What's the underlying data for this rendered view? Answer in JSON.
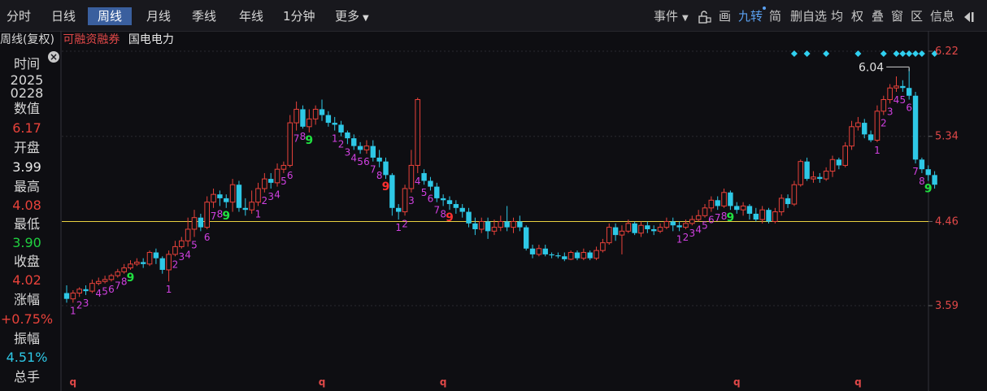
{
  "tabs": [
    {
      "label": "分时",
      "active": false
    },
    {
      "label": "日线",
      "active": false
    },
    {
      "label": "周线",
      "active": true
    },
    {
      "label": "月线",
      "active": false
    },
    {
      "label": "季线",
      "active": false
    },
    {
      "label": "年线",
      "active": false
    },
    {
      "label": "1分钟",
      "active": false
    },
    {
      "label": "更多",
      "active": false
    }
  ],
  "tools": [
    "事件",
    "画",
    "九转",
    "简",
    "删自选",
    "均",
    "权",
    "叠",
    "窗",
    "区",
    "信息"
  ],
  "subtitle": {
    "period": "周线(复权)",
    "tag": "可融资融券",
    "name": "国电电力"
  },
  "sidebar": [
    {
      "label": "时间",
      "value": "2025"
    },
    {
      "label": "",
      "value": "0228"
    },
    {
      "label": "数值",
      "value": "6.17"
    },
    {
      "label": "开盘",
      "value": "3.99"
    },
    {
      "label": "最高",
      "value": "4.08"
    },
    {
      "label": "最低",
      "value": "3.90"
    },
    {
      "label": "收盘",
      "value": "4.02"
    },
    {
      "label": "涨幅",
      "value": "+0.75%"
    },
    {
      "label": "振幅",
      "value": "4.51%"
    },
    {
      "label": "总手",
      "value": ""
    }
  ],
  "colors": {
    "up": "#e8423a",
    "down": "#2ec8e6",
    "label_red": "#e04848",
    "count_magenta": "#d040e0",
    "nine_green": "#20e040",
    "nine_red": "#ff3030",
    "crosshair": "#e8d040",
    "active_tab": "#3a5f9e"
  },
  "chart_data": {
    "type": "candlestick",
    "y_ticks": [
      6.22,
      5.34,
      4.46,
      3.59
    ],
    "ylim": [
      3.3,
      6.5
    ],
    "crosshair_value": 4.46,
    "high_label": "6.04",
    "candles": [
      [
        3.72,
        3.66,
        3.8,
        3.62
      ],
      [
        3.66,
        3.72,
        3.75,
        3.62
      ],
      [
        3.72,
        3.76,
        3.78,
        3.68
      ],
      [
        3.76,
        3.74,
        3.8,
        3.7
      ],
      [
        3.74,
        3.82,
        3.86,
        3.72
      ],
      [
        3.82,
        3.84,
        3.88,
        3.8
      ],
      [
        3.84,
        3.86,
        3.9,
        3.82
      ],
      [
        3.86,
        3.9,
        3.92,
        3.84
      ],
      [
        3.9,
        3.94,
        3.97,
        3.88
      ],
      [
        3.94,
        3.98,
        4.02,
        3.92
      ],
      [
        3.98,
        4.02,
        4.06,
        3.96
      ],
      [
        4.02,
        4.04,
        4.08,
        4.0
      ],
      [
        4.04,
        4.02,
        4.08,
        3.98
      ],
      [
        4.02,
        4.14,
        4.16,
        4.0
      ],
      [
        4.14,
        4.08,
        4.18,
        4.02
      ],
      [
        4.08,
        3.96,
        4.1,
        3.92
      ],
      [
        3.96,
        4.12,
        4.16,
        3.84
      ],
      [
        4.12,
        4.2,
        4.26,
        4.1
      ],
      [
        4.2,
        4.26,
        4.3,
        4.18
      ],
      [
        4.26,
        4.38,
        4.5,
        4.2
      ],
      [
        4.38,
        4.5,
        4.58,
        4.3
      ],
      [
        4.5,
        4.4,
        4.54,
        4.36
      ],
      [
        4.4,
        4.66,
        4.72,
        4.38
      ],
      [
        4.66,
        4.74,
        4.8,
        4.6
      ],
      [
        4.74,
        4.7,
        4.78,
        4.62
      ],
      [
        4.7,
        4.66,
        4.74,
        4.6
      ],
      [
        4.66,
        4.84,
        4.9,
        4.56
      ],
      [
        4.84,
        4.6,
        4.88,
        4.56
      ],
      [
        4.6,
        4.58,
        4.7,
        4.52
      ],
      [
        4.58,
        4.66,
        4.78,
        4.54
      ],
      [
        4.66,
        4.8,
        4.86,
        4.62
      ],
      [
        4.8,
        4.9,
        4.96,
        4.76
      ],
      [
        4.9,
        4.86,
        4.96,
        4.8
      ],
      [
        4.86,
        5.0,
        5.06,
        4.82
      ],
      [
        5.0,
        5.04,
        5.08,
        4.96
      ],
      [
        5.04,
        5.48,
        5.56,
        5.02
      ],
      [
        5.48,
        5.62,
        5.7,
        5.4
      ],
      [
        5.62,
        5.44,
        5.66,
        5.42
      ],
      [
        5.44,
        5.52,
        5.62,
        5.38
      ],
      [
        5.52,
        5.62,
        5.66,
        5.46
      ],
      [
        5.62,
        5.56,
        5.72,
        5.5
      ],
      [
        5.56,
        5.48,
        5.6,
        5.44
      ],
      [
        5.48,
        5.46,
        5.54,
        5.4
      ],
      [
        5.46,
        5.38,
        5.5,
        5.34
      ],
      [
        5.38,
        5.32,
        5.4,
        5.26
      ],
      [
        5.32,
        5.24,
        5.36,
        5.2
      ],
      [
        5.24,
        5.2,
        5.28,
        5.16
      ],
      [
        5.2,
        5.24,
        5.3,
        5.16
      ],
      [
        5.24,
        5.12,
        5.3,
        5.08
      ],
      [
        5.12,
        5.08,
        5.2,
        5.02
      ],
      [
        5.08,
        4.94,
        5.12,
        4.9
      ],
      [
        4.94,
        4.6,
        4.96,
        4.52
      ],
      [
        4.6,
        4.56,
        4.64,
        4.48
      ],
      [
        4.56,
        4.8,
        4.84,
        4.52
      ],
      [
        4.8,
        5.04,
        5.2,
        4.76
      ],
      [
        5.04,
        5.72,
        5.74,
        4.96
      ],
      [
        4.96,
        4.88,
        5.0,
        4.84
      ],
      [
        4.88,
        4.82,
        4.92,
        4.78
      ],
      [
        4.82,
        4.7,
        4.86,
        4.66
      ],
      [
        4.7,
        4.68,
        4.74,
        4.62
      ],
      [
        4.68,
        4.64,
        4.72,
        4.58
      ],
      [
        4.64,
        4.6,
        4.68,
        4.54
      ],
      [
        4.6,
        4.56,
        4.64,
        4.5
      ],
      [
        4.56,
        4.44,
        4.6,
        4.4
      ],
      [
        4.44,
        4.38,
        4.5,
        4.32
      ],
      [
        4.38,
        4.46,
        4.5,
        4.34
      ],
      [
        4.46,
        4.36,
        4.5,
        4.28
      ],
      [
        4.36,
        4.4,
        4.48,
        4.32
      ],
      [
        4.4,
        4.46,
        4.52,
        4.36
      ],
      [
        4.46,
        4.4,
        4.62,
        4.36
      ],
      [
        4.4,
        4.46,
        4.5,
        4.34
      ],
      [
        4.46,
        4.4,
        4.52,
        4.36
      ],
      [
        4.4,
        4.18,
        4.42,
        4.16
      ],
      [
        4.18,
        4.12,
        4.22,
        4.08
      ],
      [
        4.12,
        4.18,
        4.22,
        4.1
      ],
      [
        4.18,
        4.12,
        4.22,
        4.1
      ],
      [
        4.12,
        4.11,
        4.14,
        4.08
      ],
      [
        4.11,
        4.1,
        4.14,
        4.08
      ],
      [
        4.1,
        4.07,
        4.14,
        4.05
      ],
      [
        4.07,
        4.14,
        4.16,
        4.06
      ],
      [
        4.14,
        4.08,
        4.16,
        4.06
      ],
      [
        4.08,
        4.14,
        4.18,
        4.06
      ],
      [
        4.14,
        4.08,
        4.16,
        4.06
      ],
      [
        4.08,
        4.16,
        4.2,
        4.06
      ],
      [
        4.16,
        4.24,
        4.28,
        4.14
      ],
      [
        4.24,
        4.4,
        4.44,
        4.22
      ],
      [
        4.4,
        4.32,
        4.44,
        4.26
      ],
      [
        4.32,
        4.36,
        4.42,
        4.12
      ],
      [
        4.36,
        4.44,
        4.48,
        4.34
      ],
      [
        4.44,
        4.34,
        4.46,
        4.32
      ],
      [
        4.34,
        4.42,
        4.46,
        4.3
      ],
      [
        4.42,
        4.38,
        4.46,
        4.34
      ],
      [
        4.38,
        4.36,
        4.42,
        4.32
      ],
      [
        4.36,
        4.4,
        4.44,
        4.34
      ],
      [
        4.4,
        4.46,
        4.5,
        4.38
      ],
      [
        4.46,
        4.42,
        4.5,
        4.36
      ],
      [
        4.42,
        4.4,
        4.46,
        4.36
      ],
      [
        4.4,
        4.44,
        4.48,
        4.38
      ],
      [
        4.44,
        4.48,
        4.52,
        4.42
      ],
      [
        4.48,
        4.52,
        4.58,
        4.46
      ],
      [
        4.52,
        4.6,
        4.64,
        4.5
      ],
      [
        4.6,
        4.68,
        4.72,
        4.56
      ],
      [
        4.68,
        4.62,
        4.72,
        4.58
      ],
      [
        4.62,
        4.76,
        4.8,
        4.6
      ],
      [
        4.76,
        4.62,
        4.78,
        4.58
      ],
      [
        4.62,
        4.58,
        4.66,
        4.54
      ],
      [
        4.58,
        4.62,
        4.66,
        4.52
      ],
      [
        4.62,
        4.54,
        4.64,
        4.48
      ],
      [
        4.54,
        4.48,
        4.6,
        4.46
      ],
      [
        4.48,
        4.58,
        4.62,
        4.44
      ],
      [
        4.58,
        4.46,
        4.6,
        4.44
      ],
      [
        4.46,
        4.56,
        4.6,
        4.44
      ],
      [
        4.56,
        4.7,
        4.74,
        4.52
      ],
      [
        4.7,
        4.64,
        4.74,
        4.6
      ],
      [
        4.64,
        4.84,
        4.88,
        4.62
      ],
      [
        4.84,
        5.08,
        5.1,
        4.82
      ],
      [
        5.08,
        4.9,
        5.12,
        4.88
      ],
      [
        4.9,
        4.92,
        4.98,
        4.86
      ],
      [
        4.92,
        4.9,
        4.96,
        4.86
      ],
      [
        4.9,
        4.98,
        5.02,
        4.88
      ],
      [
        4.98,
        5.1,
        5.14,
        4.92
      ],
      [
        5.1,
        5.04,
        5.12,
        5.0
      ],
      [
        5.04,
        5.24,
        5.28,
        5.02
      ],
      [
        5.24,
        5.44,
        5.5,
        5.2
      ],
      [
        5.44,
        5.48,
        5.54,
        5.4
      ],
      [
        5.48,
        5.36,
        5.52,
        5.32
      ],
      [
        5.36,
        5.3,
        5.4,
        5.28
      ],
      [
        5.3,
        5.6,
        5.66,
        5.28
      ],
      [
        5.6,
        5.72,
        5.76,
        5.56
      ],
      [
        5.72,
        5.84,
        5.88,
        5.68
      ],
      [
        5.84,
        5.86,
        5.96,
        5.8
      ],
      [
        5.86,
        5.84,
        5.92,
        5.8
      ],
      [
        5.84,
        5.76,
        6.04,
        5.72
      ],
      [
        5.76,
        5.1,
        5.8,
        5.06
      ],
      [
        5.1,
        5.0,
        5.12,
        4.96
      ],
      [
        5.0,
        4.94,
        5.04,
        4.88
      ],
      [
        4.94,
        4.84,
        4.98,
        4.8
      ]
    ],
    "counts": [
      {
        "i": 1,
        "t": "1",
        "above": false
      },
      {
        "i": 2,
        "t": "2",
        "above": false
      },
      {
        "i": 3,
        "t": "3",
        "above": false
      },
      {
        "i": 5,
        "t": "4",
        "above": false
      },
      {
        "i": 6,
        "t": "5",
        "above": false
      },
      {
        "i": 7,
        "t": "6",
        "above": false
      },
      {
        "i": 8,
        "t": "7",
        "above": false
      },
      {
        "i": 9,
        "t": "8",
        "above": false
      },
      {
        "i": 10,
        "t": "9",
        "above": false,
        "nine": true
      },
      {
        "i": 16,
        "t": "1",
        "above": false
      },
      {
        "i": 17,
        "t": "2",
        "above": false
      },
      {
        "i": 18,
        "t": "3",
        "above": false
      },
      {
        "i": 19,
        "t": "4",
        "above": false
      },
      {
        "i": 20,
        "t": "5",
        "above": false
      },
      {
        "i": 22,
        "t": "6",
        "above": false
      },
      {
        "i": 23,
        "t": "7",
        "above": false
      },
      {
        "i": 24,
        "t": "8",
        "above": false
      },
      {
        "i": 25,
        "t": "9",
        "above": false,
        "nine": true
      },
      {
        "i": 30,
        "t": "1",
        "above": false
      },
      {
        "i": 31,
        "t": "2",
        "above": false
      },
      {
        "i": 32,
        "t": "3",
        "above": false
      },
      {
        "i": 33,
        "t": "4",
        "above": false
      },
      {
        "i": 34,
        "t": "5",
        "above": false
      },
      {
        "i": 35,
        "t": "6",
        "above": false
      },
      {
        "i": 36,
        "t": "7",
        "above": false
      },
      {
        "i": 37,
        "t": "8",
        "above": false
      },
      {
        "i": 38,
        "t": "9",
        "above": false,
        "nine": true
      },
      {
        "i": 42,
        "t": "1",
        "above": true
      },
      {
        "i": 43,
        "t": "2",
        "above": true
      },
      {
        "i": 44,
        "t": "3",
        "above": true
      },
      {
        "i": 45,
        "t": "4",
        "above": true
      },
      {
        "i": 46,
        "t": "5",
        "above": true
      },
      {
        "i": 47,
        "t": "6",
        "above": true
      },
      {
        "i": 48,
        "t": "7",
        "above": true
      },
      {
        "i": 49,
        "t": "8",
        "above": true
      },
      {
        "i": 50,
        "t": "9",
        "above": true,
        "redNine": true
      },
      {
        "i": 52,
        "t": "1",
        "above": true
      },
      {
        "i": 53,
        "t": "2",
        "above": true
      },
      {
        "i": 54,
        "t": "3",
        "above": true
      },
      {
        "i": 55,
        "t": "4",
        "above": true
      },
      {
        "i": 56,
        "t": "5",
        "above": true
      },
      {
        "i": 57,
        "t": "6",
        "above": true
      },
      {
        "i": 58,
        "t": "7",
        "above": true
      },
      {
        "i": 59,
        "t": "8",
        "above": true
      },
      {
        "i": 60,
        "t": "9",
        "above": true,
        "redNine": true
      },
      {
        "i": 96,
        "t": "1",
        "above": false
      },
      {
        "i": 97,
        "t": "2",
        "above": false
      },
      {
        "i": 98,
        "t": "3",
        "above": false
      },
      {
        "i": 99,
        "t": "4",
        "above": false
      },
      {
        "i": 100,
        "t": "5",
        "above": false
      },
      {
        "i": 101,
        "t": "6",
        "above": false
      },
      {
        "i": 102,
        "t": "7",
        "above": false
      },
      {
        "i": 103,
        "t": "8",
        "above": false
      },
      {
        "i": 104,
        "t": "9",
        "above": false,
        "nine": true
      },
      {
        "i": 127,
        "t": "1",
        "above": false
      },
      {
        "i": 128,
        "t": "2",
        "above": false
      },
      {
        "i": 129,
        "t": "3",
        "above": false
      },
      {
        "i": 130,
        "t": "4",
        "above": false
      },
      {
        "i": 131,
        "t": "5",
        "above": false
      },
      {
        "i": 132,
        "t": "6",
        "above": false
      },
      {
        "i": 133,
        "t": "7",
        "above": false
      },
      {
        "i": 134,
        "t": "8",
        "above": false
      },
      {
        "i": 135,
        "t": "9",
        "above": false,
        "nine": true
      }
    ],
    "diamonds": [
      114,
      116,
      119,
      124,
      128,
      130,
      131,
      132,
      133,
      134,
      136
    ],
    "q_markers": [
      1,
      40,
      59,
      105,
      124
    ]
  }
}
